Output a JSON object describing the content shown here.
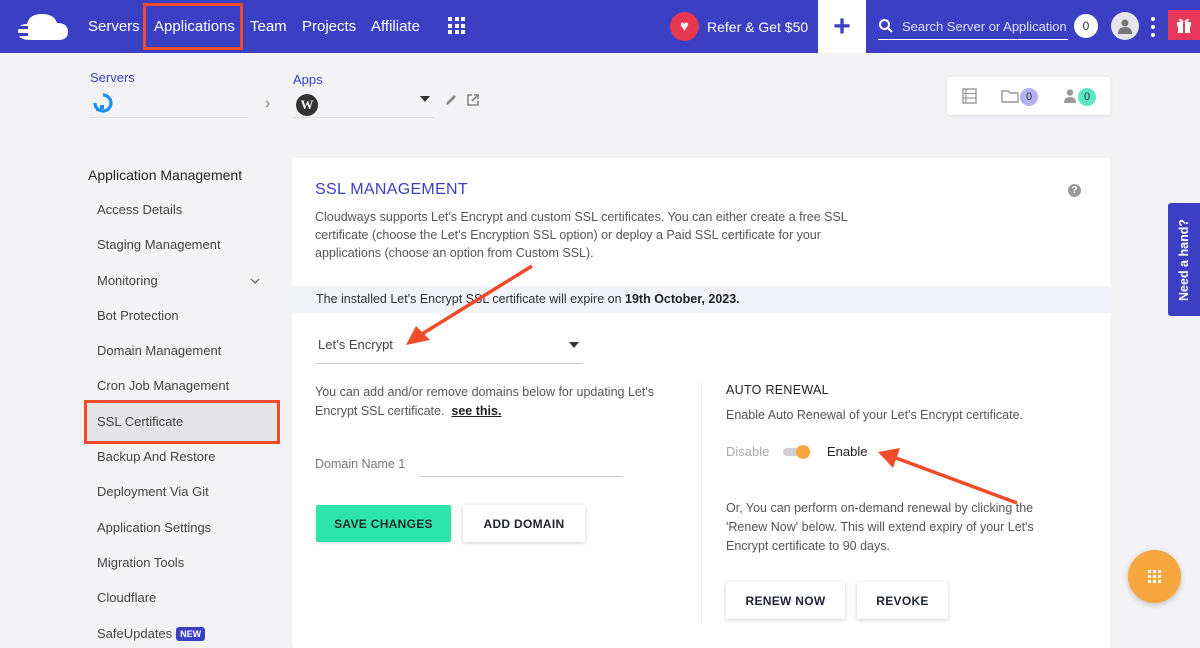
{
  "topnav": {
    "items": [
      {
        "label": "Servers"
      },
      {
        "label": "Applications"
      },
      {
        "label": "Team"
      },
      {
        "label": "Projects"
      },
      {
        "label": "Affiliate"
      }
    ],
    "refer_label": "Refer & Get $50",
    "search_placeholder": "Search Server or Application",
    "notification_count": "0"
  },
  "breadcrumb": {
    "servers_label": "Servers",
    "apps_label": "Apps"
  },
  "info_box": {
    "folder_count": "0",
    "users_count": "0"
  },
  "sidebar": {
    "heading": "Application Management",
    "items": [
      {
        "label": "Access Details"
      },
      {
        "label": "Staging Management"
      },
      {
        "label": "Monitoring"
      },
      {
        "label": "Bot Protection"
      },
      {
        "label": "Domain Management"
      },
      {
        "label": "Cron Job Management"
      },
      {
        "label": "SSL Certificate"
      },
      {
        "label": "Backup And Restore"
      },
      {
        "label": "Deployment Via Git"
      },
      {
        "label": "Application Settings"
      },
      {
        "label": "Migration Tools"
      },
      {
        "label": "Cloudflare"
      },
      {
        "label": "SafeUpdates"
      }
    ],
    "active_item": "SSL Certificate",
    "new_badge": "NEW"
  },
  "ssl": {
    "title": "SSL MANAGEMENT",
    "description": "Cloudways supports Let's Encrypt and custom SSL certificates. You can either create a free SSL certificate (choose the Let's Encryption SSL option) or deploy a Paid SSL certificate for your applications (choose an option from Custom SSL).",
    "notice_prefix": "The installed Let's Encrypt SSL certificate will expire on ",
    "notice_date": "19th October, 2023.",
    "selected_type": "Let’s Encrypt",
    "domain_desc": "You can add and/or remove domains below for updating Let's Encrypt SSL certificate.",
    "see_this": "see this.",
    "domain_label": "Domain Name 1",
    "domain_value": "",
    "save_label": "SAVE CHANGES",
    "add_domain_label": "ADD DOMAIN",
    "auto_renewal_title": "AUTO RENEWAL",
    "auto_renewal_desc": "Enable Auto Renewal of your Let's Encrypt certificate.",
    "toggle_off_label": "Disable",
    "toggle_on_label": "Enable",
    "auto_renewal_enabled": true,
    "renew_desc": "Or, You can perform on-demand renewal by clicking the 'Renew Now' below. This will extend expiry of your Let's Encrypt certificate to 90 days.",
    "renew_label": "RENEW NOW",
    "revoke_label": "REVOKE"
  },
  "widgets": {
    "need_hand": "Need a hand?"
  },
  "colors": {
    "brand": "#3a3fc4",
    "annotation": "#f04b2a",
    "save_button": "#2ee5a9",
    "toggle_knob": "#f7a640"
  }
}
